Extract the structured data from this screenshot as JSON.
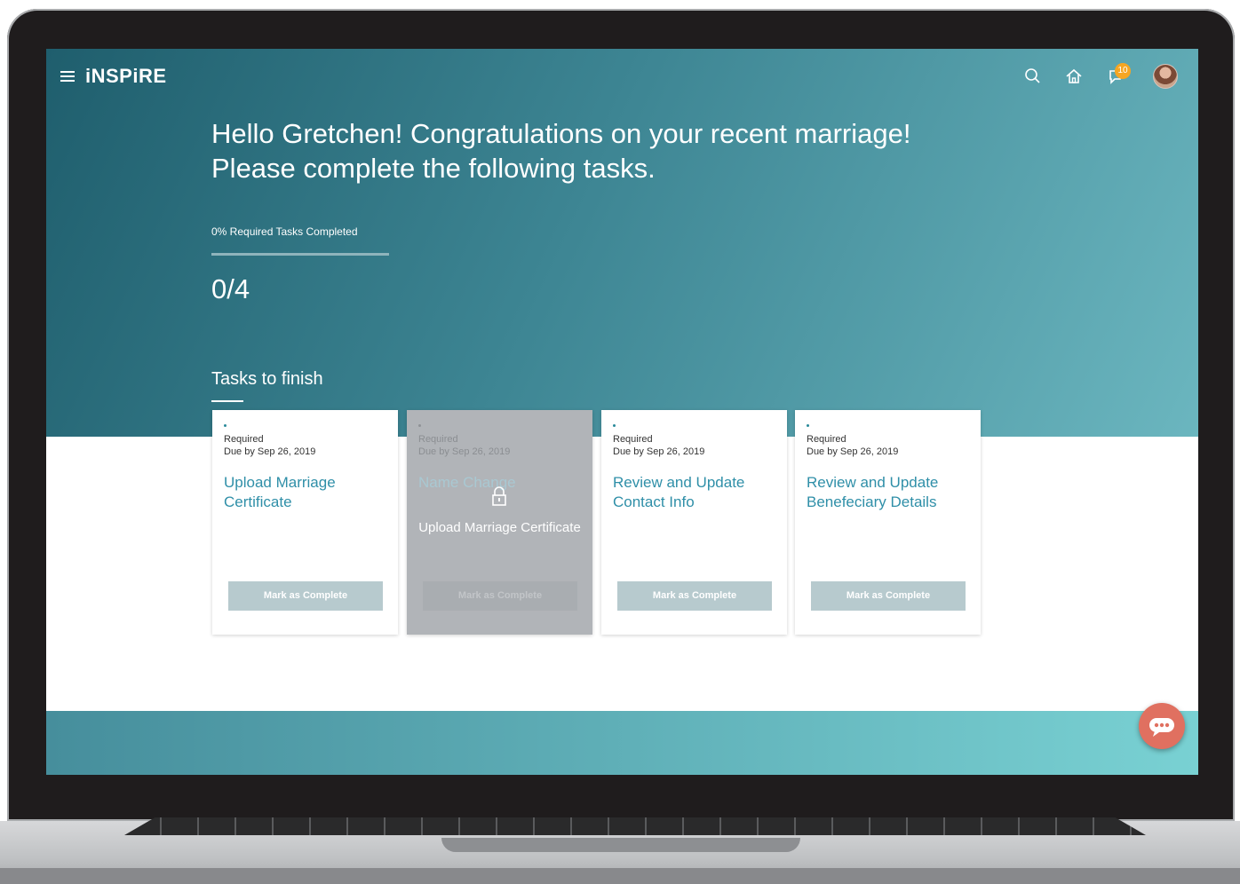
{
  "app": {
    "brand": "iNSPiRE",
    "notification_count": "10"
  },
  "icons": [
    "menu-icon",
    "search-icon",
    "home-icon",
    "notification-icon",
    "avatar",
    "lock-icon",
    "chat-icon"
  ],
  "hero": {
    "greeting": "Hello Gretchen! Congratulations on your recent marriage! Please complete the following tasks.",
    "progress_label": "0% Required Tasks Completed",
    "progress_fraction": 0,
    "count": "0/4",
    "section_title": "Tasks to finish"
  },
  "tasks": [
    {
      "required": "Required",
      "due": "Due by Sep 26, 2019",
      "title": "Upload Marriage Certificate",
      "button": "Mark as Complete",
      "locked": false
    },
    {
      "required": "Required",
      "due": "Due by Sep 26, 2019",
      "title": "Name Change",
      "button": "Mark as Complete",
      "locked": true,
      "locked_text": "Upload Marriage Certificate"
    },
    {
      "required": "Required",
      "due": "Due by Sep 26, 2019",
      "title": "Review and Update Contact Info",
      "button": "Mark as Complete",
      "locked": false
    },
    {
      "required": "Required",
      "due": "Due by Sep 26, 2019",
      "title": "Review and Update Benefeciary Details",
      "button": "Mark as Complete",
      "locked": false
    }
  ],
  "colors": {
    "accent": "#2f8fa8",
    "hero_dark": "#1f5e6d",
    "hero_light": "#6bb6bf",
    "badge": "#f5a623",
    "chat": "#e07060"
  }
}
